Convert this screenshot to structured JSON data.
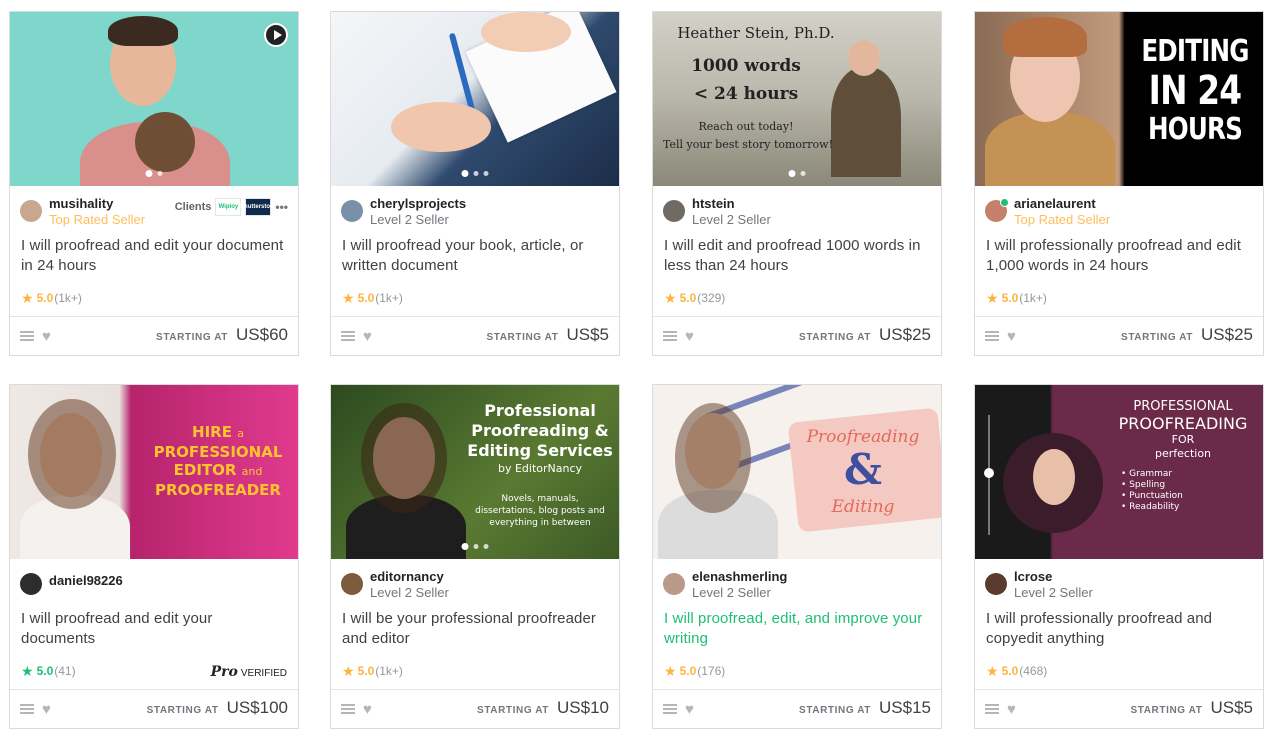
{
  "footer_label": "STARTING AT",
  "cards": [
    {
      "seller": "musihality",
      "level": "Top Rated Seller",
      "clients_label": "Clients",
      "client_logos": [
        "Wiploy",
        "Shutterstock"
      ],
      "title": "I will proofread and edit your document in 24 hours",
      "rating": "5.0",
      "count": "(1k+)",
      "price": "US$60"
    },
    {
      "seller": "cherylsprojects",
      "level": "Level 2 Seller",
      "title": "I will proofread your book, article, or written document",
      "rating": "5.0",
      "count": "(1k+)",
      "price": "US$5"
    },
    {
      "seller": "htstein",
      "level": "Level 2 Seller",
      "title": "I will edit and proofread 1000 words in less than 24 hours",
      "rating": "5.0",
      "count": "(329)",
      "price": "US$25",
      "thumb_text": [
        "Heather Stein, Ph.D.",
        "1000 words",
        "< 24 hours",
        "Reach out today!",
        "Tell your best story tomorrow!"
      ]
    },
    {
      "seller": "arianelaurent",
      "level": "Top Rated Seller",
      "title": "I will professionally proofread and edit 1,000 words in 24 hours",
      "rating": "5.0",
      "count": "(1k+)",
      "price": "US$25",
      "thumb_text": [
        "EDITING",
        "IN 24",
        "HOURS"
      ]
    },
    {
      "seller": "daniel98226",
      "level": "",
      "title": "I will proofread and edit your documents",
      "rating": "5.0",
      "count": "(41)",
      "price": "US$100",
      "pro_label": "Pro",
      "pro_verified": "VERIFIED",
      "thumb_text": [
        "HIRE",
        "a",
        "PROFESSIONAL",
        "EDITOR",
        "and",
        "PROOFREADER"
      ]
    },
    {
      "seller": "editornancy",
      "level": "Level 2 Seller",
      "title": "I will be your professional proofreader and editor",
      "rating": "5.0",
      "count": "(1k+)",
      "price": "US$10",
      "thumb_text": [
        "Professional",
        "Proofreading &",
        "Editing Services",
        "by EditorNancy",
        "Novels, manuals,",
        "dissertations, blog posts and",
        "everything in between"
      ]
    },
    {
      "seller": "elenashmerling",
      "level": "Level 2 Seller",
      "title": "I will proofread, edit, and improve your writing",
      "rating": "5.0",
      "count": "(176)",
      "price": "US$15",
      "thumb_text": [
        "Proofreading",
        "&",
        "Editing"
      ]
    },
    {
      "seller": "lcrose",
      "level": "Level 2 Seller",
      "title": "I will professionally proofread and copyedit anything",
      "rating": "5.0",
      "count": "(468)",
      "price": "US$5",
      "thumb_text": [
        "PROFESSIONAL",
        "PROOFREADING",
        "FOR",
        "perfection",
        "Grammar",
        "Spelling",
        "Punctuation",
        "Readability"
      ]
    }
  ]
}
